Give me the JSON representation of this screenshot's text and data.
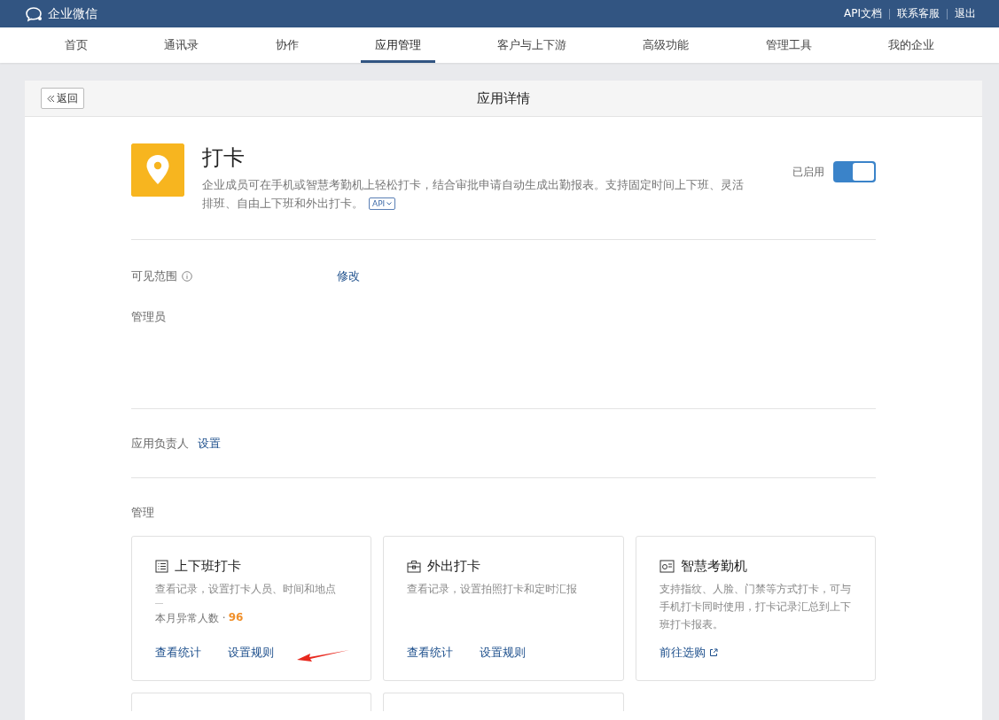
{
  "header": {
    "logo": "企业微信",
    "links": [
      "API文档",
      "联系客服",
      "退出"
    ]
  },
  "nav": [
    {
      "label": "首页",
      "selected": false
    },
    {
      "label": "通讯录",
      "selected": false
    },
    {
      "label": "协作",
      "selected": false
    },
    {
      "label": "应用管理",
      "selected": true
    },
    {
      "label": "客户与上下游",
      "selected": false
    },
    {
      "label": "高级功能",
      "selected": false
    },
    {
      "label": "管理工具",
      "selected": false
    },
    {
      "label": "我的企业",
      "selected": false
    }
  ],
  "panel": {
    "back": "返回",
    "title": "应用详情"
  },
  "app": {
    "name": "打卡",
    "description_lines": [
      "企业成员可在手机或智慧考勤机上轻松打卡，结合审批申请自动生成出勤报表。支持固定时间上下班、灵活",
      "排班、自由上下班和外出打卡。"
    ],
    "api_badge": "API",
    "status": "已启用",
    "enabled": true
  },
  "visibility": {
    "label": "可见范围",
    "action": "修改"
  },
  "admins": {
    "label": "管理员"
  },
  "owner": {
    "label": "应用负责人",
    "action": "设置"
  },
  "manage": {
    "title": "管理",
    "cards": [
      {
        "kind": "list",
        "title": "上下班打卡",
        "description": "查看记录，设置打卡人员、时间和地点",
        "stat_label": "本月异常人数 ·",
        "stat_value": "96",
        "links": [
          {
            "label": "查看统计",
            "external": false
          },
          {
            "label": "设置规则",
            "external": false
          }
        ]
      },
      {
        "kind": "briefcase",
        "title": "外出打卡",
        "description": "查看记录，设置拍照打卡和定时汇报",
        "links": [
          {
            "label": "查看统计",
            "external": false
          },
          {
            "label": "设置规则",
            "external": false
          }
        ]
      },
      {
        "kind": "device",
        "title": "智慧考勤机",
        "description": "支持指纹、人脸、门禁等方式打卡，可与手机打卡同时使用，打卡记录汇总到上下班打卡报表。",
        "links": [
          {
            "label": "前往选购",
            "external": true
          }
        ]
      }
    ]
  }
}
